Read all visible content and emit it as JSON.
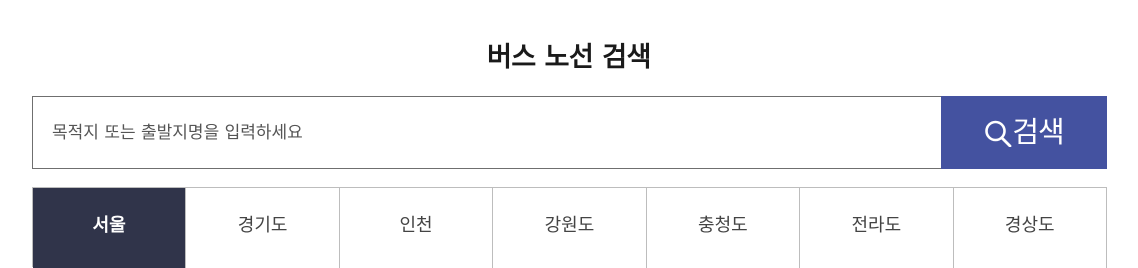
{
  "page": {
    "title": "버스 노선 검색"
  },
  "search": {
    "placeholder": "목적지 또는 출발지명을 입력하세요",
    "value": "",
    "button_label": "검색",
    "button_icon": "search-icon"
  },
  "regions": {
    "selected": "서울",
    "tabs": [
      {
        "label": "서울"
      },
      {
        "label": "경기도"
      },
      {
        "label": "인천"
      },
      {
        "label": "강원도"
      },
      {
        "label": "충청도"
      },
      {
        "label": "전라도"
      },
      {
        "label": "경상도"
      }
    ]
  },
  "colors": {
    "search_button_bg": "#4452a0",
    "active_tab_bg": "#30344a",
    "border": "#bdbdbd"
  }
}
